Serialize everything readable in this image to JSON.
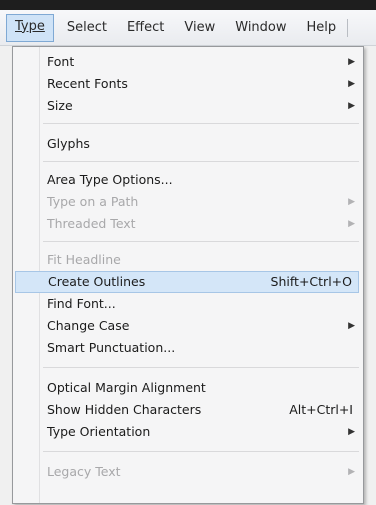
{
  "menubar": {
    "items": [
      {
        "label": "Type",
        "active": true
      },
      {
        "label": "Select"
      },
      {
        "label": "Effect"
      },
      {
        "label": "View"
      },
      {
        "label": "Window"
      },
      {
        "label": "Help"
      }
    ]
  },
  "type_menu": {
    "items": [
      {
        "label": "Font",
        "submenu": true
      },
      {
        "label": "Recent Fonts",
        "submenu": true
      },
      {
        "label": "Size",
        "submenu": true
      },
      {
        "label": "Glyphs"
      },
      {
        "label": "Area Type Options..."
      },
      {
        "label": "Type on a Path",
        "submenu": true,
        "disabled": true
      },
      {
        "label": "Threaded Text",
        "submenu": true,
        "disabled": true
      },
      {
        "label": "Fit Headline",
        "disabled": true
      },
      {
        "label": "Create Outlines",
        "shortcut": "Shift+Ctrl+O",
        "highlighted": true
      },
      {
        "label": "Find Font..."
      },
      {
        "label": "Change Case",
        "submenu": true
      },
      {
        "label": "Smart Punctuation..."
      },
      {
        "label": "Optical Margin Alignment"
      },
      {
        "label": "Show Hidden Characters",
        "shortcut": "Alt+Ctrl+I"
      },
      {
        "label": "Type Orientation",
        "submenu": true
      },
      {
        "label": "Legacy Text",
        "submenu": true,
        "disabled": true
      }
    ]
  },
  "icons": {
    "submenu_arrow": "chevron-right-icon"
  },
  "colors": {
    "highlight_bg": "#d4e6f8",
    "menubar_active_bg": "#cfe3f7",
    "disabled_text": "#a8a8aa"
  }
}
